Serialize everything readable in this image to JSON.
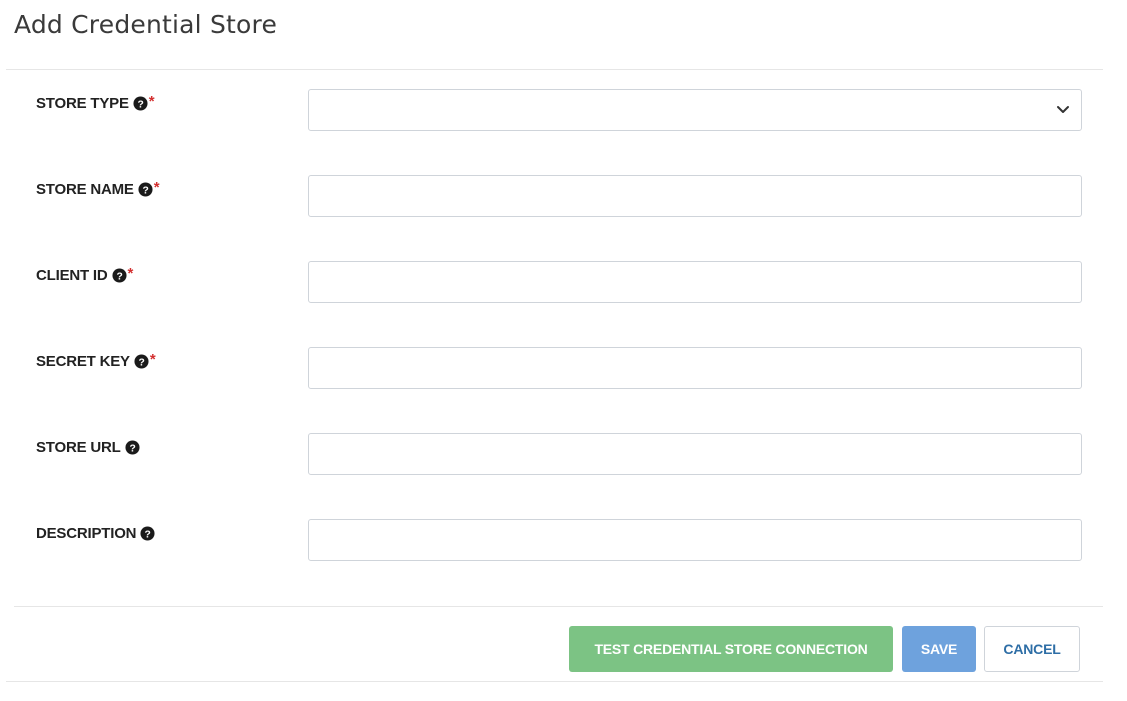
{
  "page": {
    "title": "Add Credential Store"
  },
  "form": {
    "fields": [
      {
        "label": "STORE TYPE",
        "required": "*",
        "type": "select",
        "value": "",
        "icon": "question-circle-icon"
      },
      {
        "label": "STORE NAME",
        "required": "*",
        "type": "text",
        "value": "",
        "icon": "question-circle-icon"
      },
      {
        "label": "CLIENT ID",
        "required": "*",
        "type": "text",
        "value": "",
        "icon": "question-circle-icon"
      },
      {
        "label": "SECRET KEY",
        "required": "*",
        "type": "text",
        "value": "",
        "icon": "question-circle-icon"
      },
      {
        "label": "STORE URL",
        "required": "",
        "type": "text",
        "value": "",
        "icon": "question-circle-icon"
      },
      {
        "label": "DESCRIPTION",
        "required": "",
        "type": "text",
        "value": "",
        "icon": "question-circle-icon"
      }
    ]
  },
  "actions": {
    "test_label": "TEST CREDENTIAL STORE CONNECTION",
    "save_label": "SAVE",
    "cancel_label": "CANCEL"
  },
  "colors": {
    "test_button": "#7cc384",
    "save_button": "#6ea2dd",
    "cancel_text": "#2e6ea6",
    "required_mark": "#d32f2f"
  }
}
